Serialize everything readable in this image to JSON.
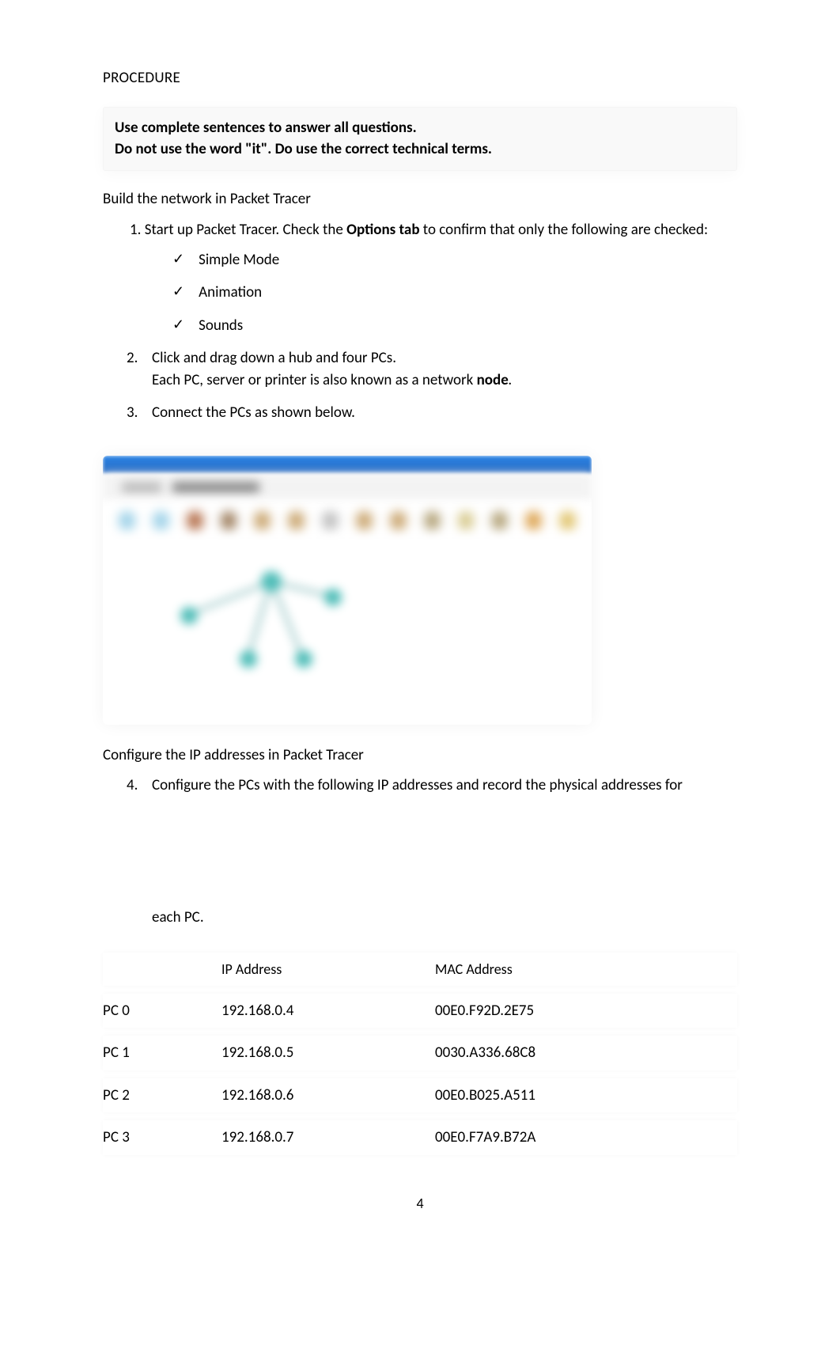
{
  "heading": "PROCEDURE",
  "callout": {
    "line1": "Use complete sentences to answer all questions.",
    "line2": "Do not use the word \"it\".  Do use the correct technical terms."
  },
  "build_section": "Build the network in Packet Tracer",
  "step1": {
    "prefix": "1. Start up Packet Tracer.  Check the ",
    "bold": "Options tab",
    "suffix": " to confirm that only the following are checked:"
  },
  "checks": [
    "Simple Mode",
    "Animation",
    "Sounds"
  ],
  "step2": {
    "num": "2.",
    "line1": "Click and drag down a hub and four PCs.",
    "line2_prefix": "Each PC, server or printer is also known as a network ",
    "line2_bold": "node",
    "line2_suffix": "."
  },
  "step3": {
    "num": "3.",
    "text": "Connect the PCs as shown below."
  },
  "config_section": "Configure the IP addresses in Packet Tracer",
  "step4": {
    "num": "4.",
    "text": "Configure the PCs with the following IP addresses and record the physical addresses for"
  },
  "each_pc": "each PC.",
  "table": {
    "headers": {
      "pc": "",
      "ip": "IP Address",
      "mac": "MAC Address"
    },
    "rows": [
      {
        "pc": "PC 0",
        "ip": "192.168.0.4",
        "mac": "00E0.F92D.2E75"
      },
      {
        "pc": "PC 1",
        "ip": "192.168.0.5",
        "mac": "0030.A336.68C8"
      },
      {
        "pc": "PC 2",
        "ip": "192.168.0.6",
        "mac": "00E0.B025.A511"
      },
      {
        "pc": "PC 3",
        "ip": "192.168.0.7",
        "mac": "00E0.F7A9.B72A"
      }
    ]
  },
  "page_number": "4"
}
